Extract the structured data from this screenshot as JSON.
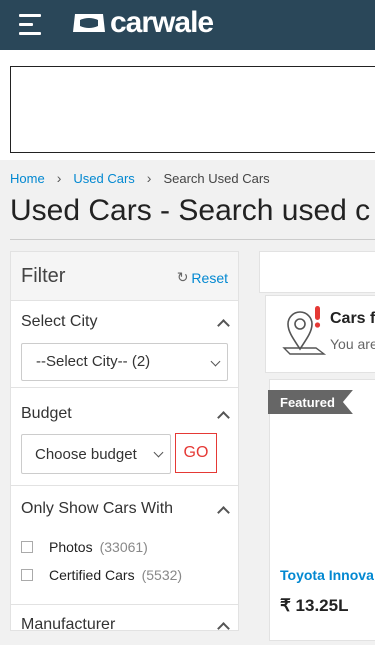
{
  "header": {
    "brand": "carwale"
  },
  "breadcrumb": {
    "home": "Home",
    "used_cars": "Used Cars",
    "current": "Search Used Cars"
  },
  "page": {
    "title": "Used Cars - Search used c"
  },
  "filter": {
    "title": "Filter",
    "reset": "Reset",
    "city": {
      "title": "Select City",
      "value": "--Select City-- (2)"
    },
    "budget": {
      "title": "Budget",
      "value": "Choose budget",
      "go": "GO"
    },
    "show_with": {
      "title": "Only Show Cars With",
      "options": [
        {
          "label": "Photos",
          "count": "(33061)"
        },
        {
          "label": "Certified Cars",
          "count": "(5532)"
        }
      ]
    },
    "manufacturer": {
      "title": "Manufacturer"
    }
  },
  "results": {
    "cars_for": "Cars f",
    "you_are": "You are",
    "card": {
      "badge": "Featured",
      "name": "Toyota Innova",
      "price": "₹ 13.25L"
    }
  },
  "colors": {
    "header_bg": "#2a4759",
    "link": "#0288d1",
    "go_red": "#e53935"
  }
}
